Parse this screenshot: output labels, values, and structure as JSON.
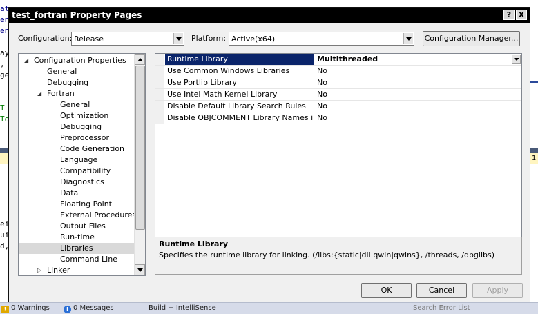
{
  "ide": {
    "code_lines": [
      "at",
      "en",
      "en",
      "ay,",
      ",",
      "ge",
      "T",
      "To",
      "ei",
      "ui",
      "d,"
    ],
    "line_marker": "1",
    "status": {
      "warnings": "0 Warnings",
      "messages": "0 Messages",
      "build_filter": "Build + IntelliSense",
      "search_placeholder": "Search Error List"
    }
  },
  "dialog": {
    "title": "test_fortran Property Pages",
    "help_glyph": "?",
    "close_glyph": "X",
    "configuration": {
      "label": "Configuration:",
      "value": "Release"
    },
    "platform": {
      "label": "Platform:",
      "value": "Active(x64)"
    },
    "config_manager_label": "Configuration Manager...",
    "tree": [
      {
        "label": "Configuration Properties",
        "level": 0,
        "expander": "expanded"
      },
      {
        "label": "General",
        "level": 1
      },
      {
        "label": "Debugging",
        "level": 1
      },
      {
        "label": "Fortran",
        "level": 1,
        "expander": "expanded"
      },
      {
        "label": "General",
        "level": 2
      },
      {
        "label": "Optimization",
        "level": 2
      },
      {
        "label": "Debugging",
        "level": 2
      },
      {
        "label": "Preprocessor",
        "level": 2
      },
      {
        "label": "Code Generation",
        "level": 2
      },
      {
        "label": "Language",
        "level": 2
      },
      {
        "label": "Compatibility",
        "level": 2
      },
      {
        "label": "Diagnostics",
        "level": 2
      },
      {
        "label": "Data",
        "level": 2
      },
      {
        "label": "Floating Point",
        "level": 2
      },
      {
        "label": "External Procedures",
        "level": 2
      },
      {
        "label": "Output Files",
        "level": 2
      },
      {
        "label": "Run-time",
        "level": 2
      },
      {
        "label": "Libraries",
        "level": 2,
        "selected": true
      },
      {
        "label": "Command Line",
        "level": 2
      },
      {
        "label": "Linker",
        "level": 1,
        "expander": "collapsed"
      }
    ],
    "properties": [
      {
        "name": "Runtime Library",
        "value": "Multithreaded",
        "selected": true
      },
      {
        "name": "Use Common Windows Libraries",
        "value": "No"
      },
      {
        "name": "Use Portlib Library",
        "value": "No"
      },
      {
        "name": "Use Intel Math Kernel Library",
        "value": "No"
      },
      {
        "name": "Disable Default Library Search Rules",
        "value": "No"
      },
      {
        "name": "Disable OBJCOMMENT Library Names in Object",
        "value": "No"
      }
    ],
    "description": {
      "title": "Runtime Library",
      "text": "Specifies the runtime library for linking.  (/libs:{static|dll|qwin|qwins}, /threads, /dbglibs)"
    },
    "buttons": {
      "ok": "OK",
      "cancel": "Cancel",
      "apply": "Apply"
    },
    "colors": {
      "selection": "#0a246a",
      "titlebar": "#000000",
      "dialog_bg": "#f0f0f0"
    }
  }
}
